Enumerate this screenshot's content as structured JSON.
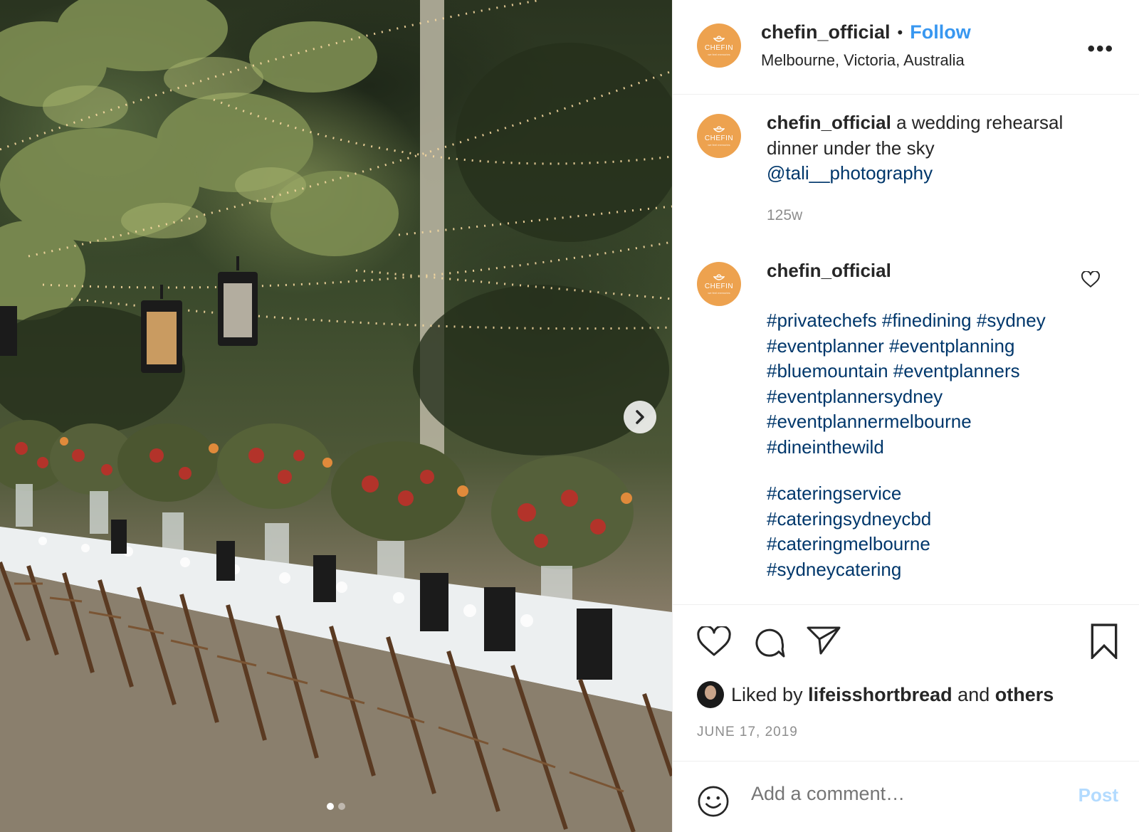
{
  "post": {
    "username": "chefin_official",
    "follow_label": "Follow",
    "separator": "•",
    "location": "Melbourne, Victoria, Australia",
    "more_label": "•••",
    "avatar_brand": "CHEFIN",
    "avatar_tagline": "we feel memories",
    "avatar_color": "#eda24f",
    "caption": {
      "username": "chefin_official",
      "text": "a wedding rehearsal dinner under the sky",
      "mention": "@tali__photography",
      "time_ago": "125w"
    },
    "comment": {
      "username": "chefin_official",
      "hashtag_lines_1": [
        "#privatechefs #finedining #sydney",
        "#eventplanner #eventplanning",
        "#bluemountain #eventplanners",
        "#eventplannersydney",
        "#eventplannermelbourne",
        "#dineinthewild"
      ],
      "hashtag_lines_2": [
        "#cateringservice",
        "#cateringsydneycbd",
        "#cateringmelbourne",
        "#sydneycatering"
      ]
    },
    "likes": {
      "prefix": "Liked by",
      "user": "lifeisshortbread",
      "middle": "and",
      "others": "others"
    },
    "date": "JUNE 17, 2019",
    "comment_placeholder": "Add a comment…",
    "post_label": "Post",
    "link_color": "#00376b",
    "follow_color": "#3897f0",
    "carousel": {
      "current": 1,
      "total": 2
    }
  }
}
